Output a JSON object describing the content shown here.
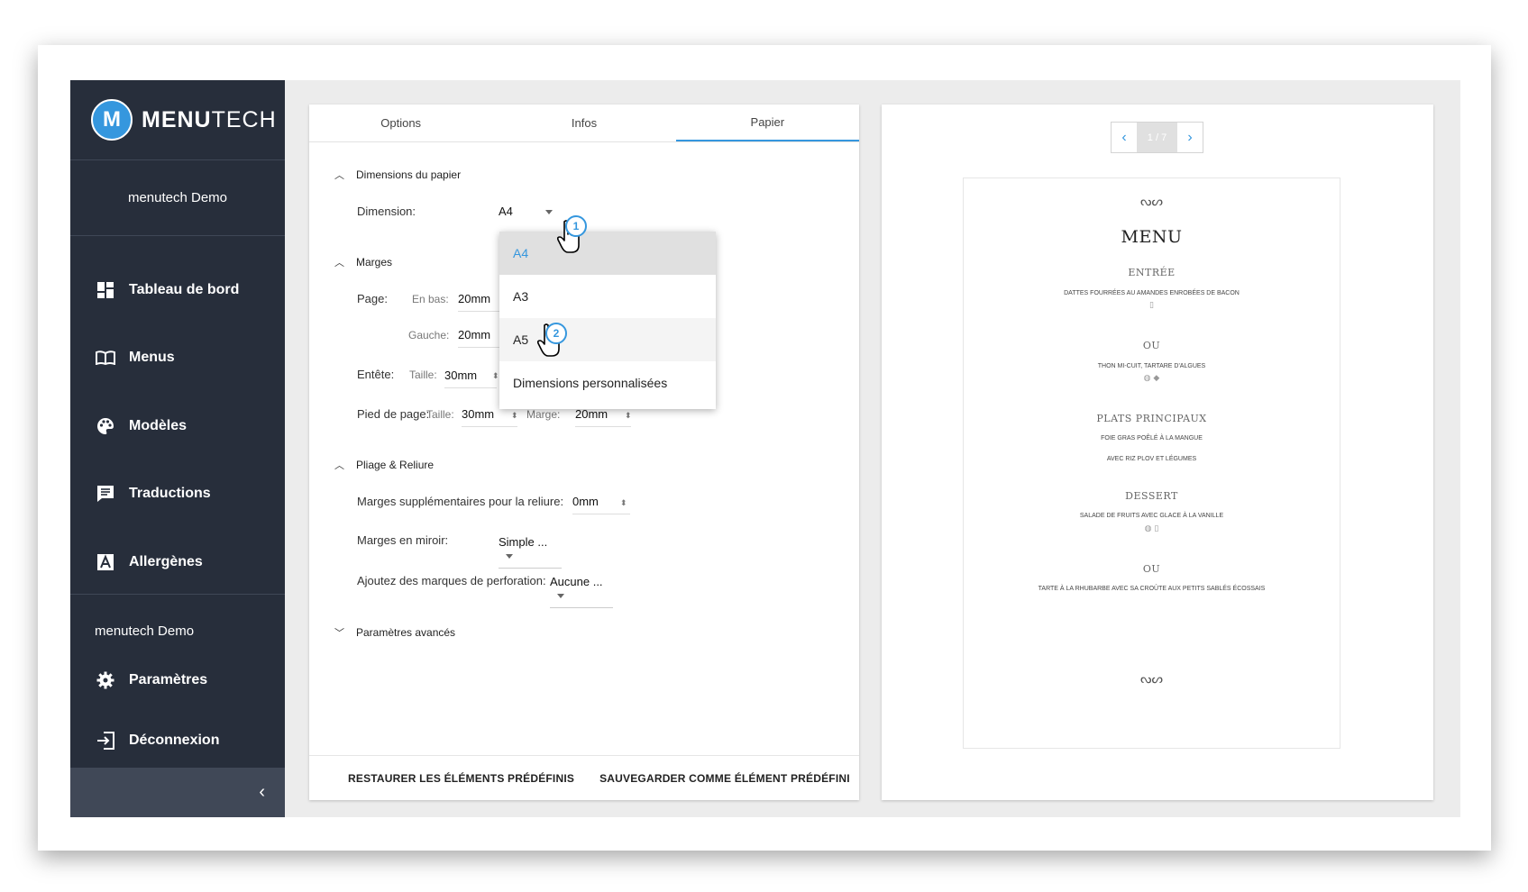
{
  "brand": {
    "bold": "MENU",
    "light": "TECH",
    "logo_letter": "M"
  },
  "sidebar": {
    "user_top": "menutech Demo",
    "items": [
      {
        "label": "Tableau de bord",
        "icon": "dashboard-icon"
      },
      {
        "label": "Menus",
        "icon": "book-icon"
      },
      {
        "label": "Modèles",
        "icon": "palette-icon"
      },
      {
        "label": "Traductions",
        "icon": "translate-icon"
      },
      {
        "label": "Allergènes",
        "icon": "allergen-icon"
      }
    ],
    "user_bottom": "menutech Demo",
    "settings": "Paramètres",
    "logout": "Déconnexion",
    "collapse": "‹"
  },
  "tabs": [
    {
      "label": "Options"
    },
    {
      "label": "Infos"
    },
    {
      "label": "Papier",
      "active": true
    }
  ],
  "paper": {
    "section_dimensions": "Dimensions du papier",
    "dimension_label": "Dimension:",
    "dimension_value": "A4",
    "section_margins": "Marges",
    "page_label": "Page:",
    "bottom_label": "En bas:",
    "bottom_value": "20mm",
    "left_label": "Gauche:",
    "left_value": "20mm",
    "header_label": "Entête:",
    "header_size_label": "Taille:",
    "header_size_value": "30mm",
    "footer_label": "Pied de page:",
    "footer_size_label": "Taille:",
    "footer_size_value": "30mm",
    "footer_margin_label": "Marge:",
    "footer_margin_value": "20mm",
    "section_folding": "Pliage & Reliure",
    "binding_label": "Marges supplémentaires pour la reliure:",
    "binding_value": "0mm",
    "mirror_label": "Marges en miroir:",
    "mirror_value": "Simple ...",
    "perforation_label": "Ajoutez des marques de perforation:",
    "perforation_value": "Aucune ...",
    "section_advanced": "Paramètres avancés"
  },
  "dropdown": {
    "options": [
      "A4",
      "A3",
      "A5",
      "Dimensions personnalisées"
    ],
    "selected": "A4",
    "hovered": "A5"
  },
  "callouts": [
    "1",
    "2"
  ],
  "footer": {
    "restore": "RESTAURER LES ÉLÉMENTS PRÉDÉFINIS",
    "save": "SAUVEGARDER COMME ÉLÉMENT PRÉDÉFINI"
  },
  "preview": {
    "pager": {
      "prev": "‹",
      "current": "1 / 7",
      "next": "›"
    },
    "flourish": "ᔓᔕ",
    "title": "MENU",
    "sections": [
      {
        "heading": "ENTRÉE",
        "items": [
          "DATTES FOURRÉES AU AMANDES ENROBÉES DE BACON"
        ],
        "icons": "▯"
      },
      {
        "heading": "OU",
        "items": [
          "THON MI-CUIT, TARTARE D'ALGUES"
        ],
        "icons": "◍ ◆"
      },
      {
        "heading": "PLATS PRINCIPAUX",
        "items": [
          "FOIE GRAS POÊLÉ À LA MANGUE",
          "AVEC RIZ PLOV ET LÉGUMES"
        ],
        "icons": ""
      },
      {
        "heading": "DESSERT",
        "items": [
          "SALADE DE FRUITS AVEC GLACE À LA VANILLE"
        ],
        "icons": "◍ ▯"
      },
      {
        "heading": "OU",
        "items": [
          "TARTE À LA RHUBARBE AVEC SA CROÛTE AUX PETITS SABLÉS ÉCOSSAIS"
        ],
        "icons": ""
      }
    ]
  },
  "colors": {
    "accent": "#3597de",
    "sidebar_bg": "#272e3b",
    "sidebar_footer": "#404857"
  }
}
